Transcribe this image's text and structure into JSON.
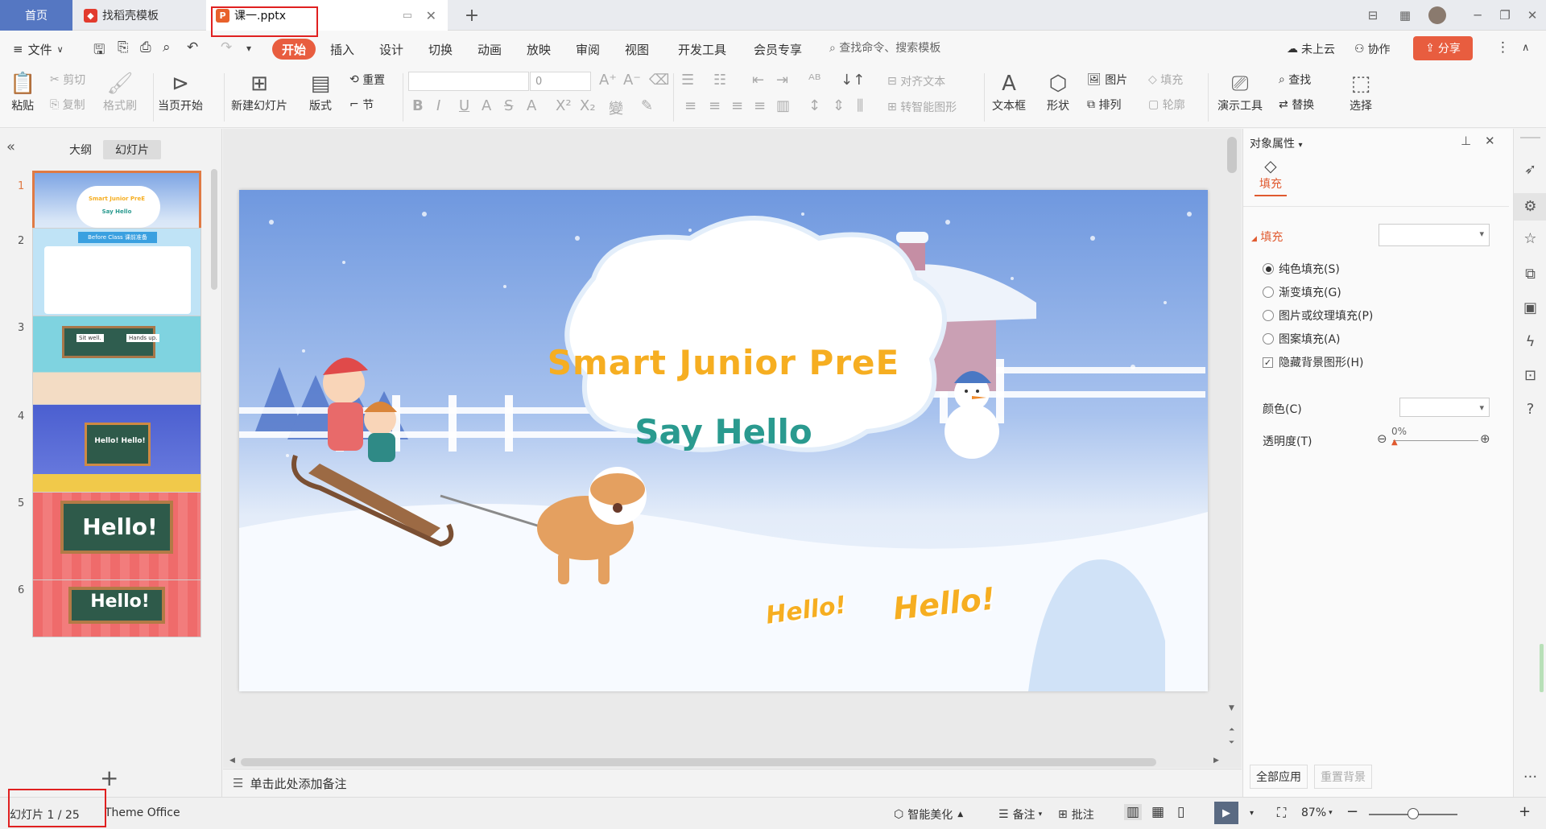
{
  "tabs": {
    "home": "首页",
    "template": "找稻壳模板",
    "document": "课一.pptx"
  },
  "menu": {
    "file": "文件",
    "items": [
      "开始",
      "插入",
      "设计",
      "切换",
      "动画",
      "放映",
      "审阅",
      "视图",
      "开发工具",
      "会员专享"
    ],
    "search": "查找命令、搜索模板",
    "cloud": "未上云",
    "collab": "协作",
    "share": "分享"
  },
  "ribbon": {
    "paste": "粘贴",
    "cut": "剪切",
    "copy": "复制",
    "format_painter": "格式刷",
    "play_from_current": "当页开始",
    "new_slide": "新建幻灯片",
    "layout": "版式",
    "reset": "重置",
    "section": "节",
    "font_size_value": "0",
    "align_text": "对齐文本",
    "smart_shape": "转智能图形",
    "textbox": "文本框",
    "shape": "形状",
    "picture": "图片",
    "arrange": "排列",
    "fill": "填充",
    "outline": "轮廓",
    "present_tools": "演示工具",
    "find": "查找",
    "replace": "替换",
    "select": "选择"
  },
  "left_panel": {
    "outline_tab": "大纲",
    "slides_tab": "幻灯片",
    "thumbs": [
      {
        "num": "1",
        "title": "Smart Junior PreE",
        "sub": "Say Hello"
      },
      {
        "num": "2",
        "title": "Before Class 课前准备"
      },
      {
        "num": "3",
        "label_a": "Sit well.",
        "label_b": "Hands up."
      },
      {
        "num": "4",
        "title": "Hello! Hello!"
      },
      {
        "num": "5",
        "title": "Hello!"
      },
      {
        "num": "6",
        "title": "Hello!"
      }
    ]
  },
  "slide": {
    "title": "Smart Junior PreE",
    "subtitle": "Say Hello",
    "hello_small": "Hello!",
    "hello_big": "Hello!"
  },
  "notes_placeholder": "单击此处添加备注",
  "props": {
    "title": "对象属性",
    "fill_tab": "填充",
    "fill_section": "填充",
    "options": [
      {
        "label": "纯色填充(S)",
        "selected": true
      },
      {
        "label": "渐变填充(G)",
        "selected": false
      },
      {
        "label": "图片或纹理填充(P)",
        "selected": false
      },
      {
        "label": "图案填充(A)",
        "selected": false
      }
    ],
    "hide_bg": "隐藏背景图形(H)",
    "hide_bg_checked": true,
    "color_label": "颜色(C)",
    "transparency_label": "透明度(T)",
    "transparency_value": "0%",
    "apply_all": "全部应用",
    "reset_bg": "重置背景"
  },
  "status": {
    "slide_counter": "幻灯片 1 / 25",
    "theme": "Theme Office",
    "beautify": "智能美化",
    "notes": "备注",
    "comments": "批注",
    "zoom": "87%",
    "zoom_fraction": 0.5
  }
}
